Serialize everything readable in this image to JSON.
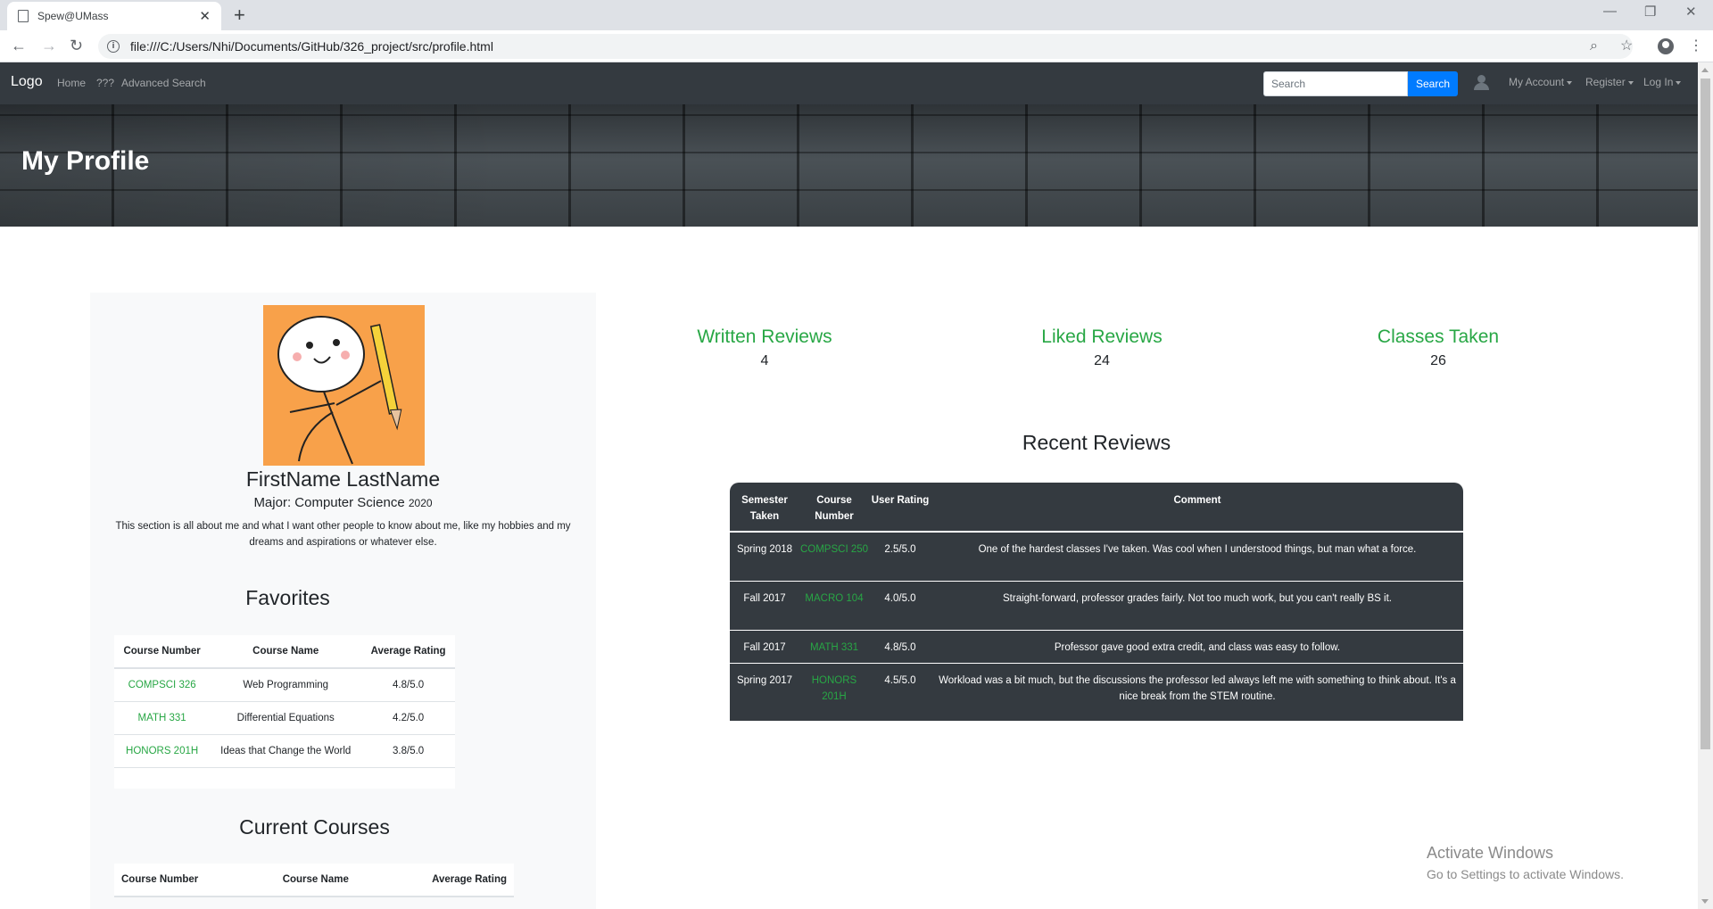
{
  "browser": {
    "tab_title": "Spew@UMass",
    "url": "file:///C:/Users/Nhi/Documents/GitHub/326_project/src/profile.html"
  },
  "navbar": {
    "brand": "Logo",
    "links": [
      "Home",
      "???",
      "Advanced Search"
    ],
    "search_placeholder": "Search",
    "search_button": "Search",
    "dropdowns": [
      "My Account",
      "Register",
      "Log In"
    ]
  },
  "hero": {
    "title": "My Profile"
  },
  "profile": {
    "name": "FirstName LastName",
    "major": "Major: Computer Science",
    "year": "2020",
    "bio": "This section is all about me and what I want other people to know about me, like my hobbies and my dreams and aspirations or whatever else."
  },
  "favorites": {
    "title": "Favorites",
    "headers": [
      "Course Number",
      "Course Name",
      "Average Rating"
    ],
    "rows": [
      [
        "COMPSCI 326",
        "Web Programming",
        "4.8/5.0"
      ],
      [
        "MATH 331",
        "Differential Equations",
        "4.2/5.0"
      ],
      [
        "HONORS 201H",
        "Ideas that Change the World",
        "3.8/5.0"
      ]
    ]
  },
  "current_courses": {
    "title": "Current Courses",
    "headers": [
      "Course Number",
      "Course Name",
      "Average Rating"
    ]
  },
  "stats": [
    {
      "label": "Written Reviews",
      "value": "4"
    },
    {
      "label": "Liked Reviews",
      "value": "24"
    },
    {
      "label": "Classes Taken",
      "value": "26"
    }
  ],
  "recent_reviews": {
    "title": "Recent Reviews",
    "headers": [
      "Semester Taken",
      "Course Number",
      "User Rating",
      "Comment"
    ],
    "rows": [
      [
        "Spring 2018",
        "COMPSCI 250",
        "2.5/5.0",
        "One of the hardest classes I've taken. Was cool when I understood things, but man what a force."
      ],
      [
        "Fall 2017",
        "MACRO 104",
        "4.0/5.0",
        "Straight-forward, professor grades fairly. Not too much work, but you can't really BS it."
      ],
      [
        "Fall 2017",
        "MATH 331",
        "4.8/5.0",
        "Professor gave good extra credit, and class was easy to follow."
      ],
      [
        "Spring 2017",
        "HONORS 201H",
        "4.5/5.0",
        "Workload was a bit much, but the discussions the professor led always left me with something to think about. It's a nice break from the STEM routine."
      ]
    ]
  },
  "watermark": {
    "line1": "Activate Windows",
    "line2": "Go to Settings to activate Windows."
  },
  "colors": {
    "navbar": "#343a40",
    "accent_green": "#28a745",
    "search_blue": "#007bff",
    "avatar_bg": "#f8a14a"
  }
}
